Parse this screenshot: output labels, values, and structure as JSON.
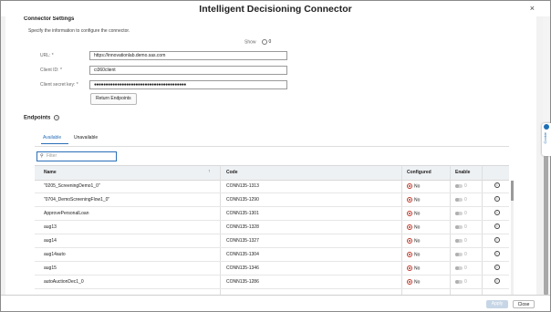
{
  "dialog": {
    "title": "Intelligent Decisioning Connector",
    "close_glyph": "×"
  },
  "connector": {
    "heading": "Connector Settings",
    "description": "Specify the information to configure the connector.",
    "show_label": "Show",
    "show_value": "0",
    "url_label": "URL: *",
    "url_value": "https://innovationlab.demo.sas.com",
    "client_id_label": "Client ID: *",
    "client_id_value": "ci360client",
    "secret_label": "Client secret key: *",
    "secret_value": "●●●●●●●●●●●●●●●●●●●●●●●●●●●●●●●●●●●●●●●●",
    "return_button": "Return Endpoints"
  },
  "endpoints": {
    "heading": "Endpoints",
    "info_glyph": "i",
    "tabs": [
      {
        "label": "Available"
      },
      {
        "label": "Unavailable"
      }
    ],
    "filter_placeholder": "Filter",
    "columns": {
      "name": "Name",
      "code": "Code",
      "configured": "Configured",
      "enable": "Enable"
    },
    "sort_glyph": "↑",
    "rows": [
      {
        "name": "\"0205_ScreeningDemo1_0\"",
        "code": "CONN135-1313",
        "configured": "No",
        "enable": "0"
      },
      {
        "name": "\"0704_DemoScreeningFlow1_0\"",
        "code": "CONN135-1290",
        "configured": "No",
        "enable": "0"
      },
      {
        "name": "ApprovePersonalLoan",
        "code": "CONN135-1301",
        "configured": "No",
        "enable": "0"
      },
      {
        "name": "aug13",
        "code": "CONN135-1328",
        "configured": "No",
        "enable": "0"
      },
      {
        "name": "aug14",
        "code": "CONN135-1327",
        "configured": "No",
        "enable": "0"
      },
      {
        "name": "aug14auto",
        "code": "CONN135-1304",
        "configured": "No",
        "enable": "0"
      },
      {
        "name": "aug15",
        "code": "CONN135-1346",
        "configured": "No",
        "enable": "0"
      },
      {
        "name": "autoAuctionDec1_0",
        "code": "CONN135-1286",
        "configured": "No",
        "enable": "0"
      }
    ]
  },
  "cookie_tab": {
    "label": "Cookie"
  },
  "footer": {
    "apply": "Apply",
    "close": "Close"
  },
  "colors": {
    "accent": "#2a6fb8",
    "no_status": "#c0392b",
    "apply_disabled": "#c7d6e6"
  },
  "icons": {
    "filter": "search-icon",
    "row_info": "info-icon",
    "configured": "no-status-icon",
    "enable": "toggle-off"
  }
}
